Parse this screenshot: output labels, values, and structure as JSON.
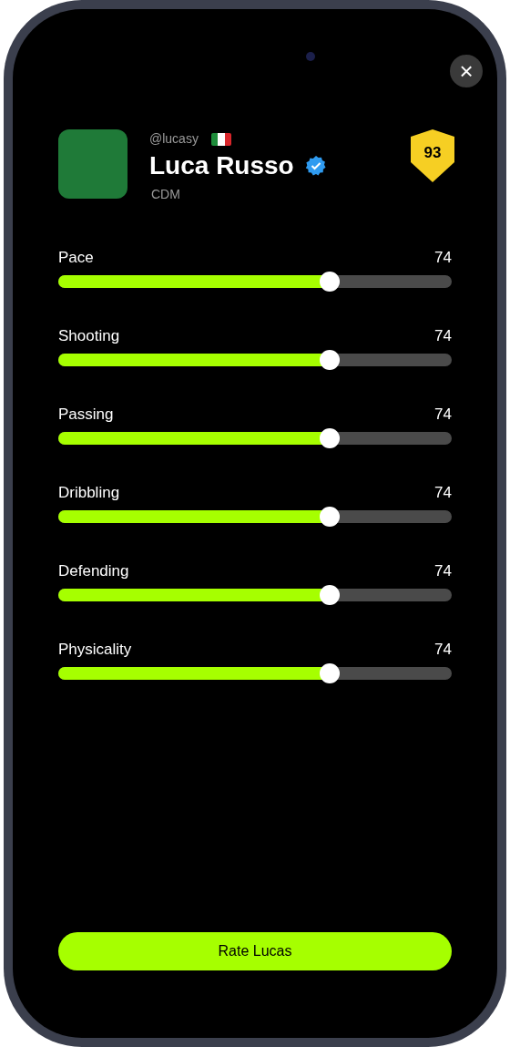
{
  "close_button": {
    "label": "×"
  },
  "profile": {
    "handle": "@lucasy",
    "name": "Luca Russo",
    "verified": true,
    "position": "CDM",
    "rating": "93"
  },
  "stats": [
    {
      "label": "Pace",
      "reading": "74",
      "level": 0.69
    },
    {
      "label": "Shooting",
      "reading": "74",
      "level": 0.69
    },
    {
      "label": "Passing",
      "reading": "74",
      "level": 0.69
    },
    {
      "label": "Dribbling",
      "reading": "74",
      "level": 0.69
    },
    {
      "label": "Defending",
      "reading": "74",
      "level": 0.69
    },
    {
      "label": "Physicality",
      "reading": "74",
      "level": 0.69
    }
  ],
  "action_button": {
    "label": "Rate Lucas"
  }
}
